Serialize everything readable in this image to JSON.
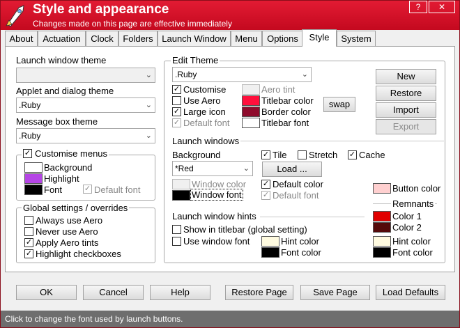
{
  "header": {
    "title": "Style and appearance",
    "subtitle": "Changes made on this page are effective immediately",
    "help_glyph": "?",
    "close_glyph": "✕"
  },
  "tabs": [
    {
      "label": "About"
    },
    {
      "label": "Actuation"
    },
    {
      "label": "Clock"
    },
    {
      "label": "Folders"
    },
    {
      "label": "Launch Window"
    },
    {
      "label": "Menu"
    },
    {
      "label": "Options"
    },
    {
      "label": "Style"
    },
    {
      "label": "System"
    }
  ],
  "active_tab": "Style",
  "left": {
    "launch_window_theme_label": "Launch window theme",
    "launch_window_theme_value": "",
    "applet_theme_label": "Applet and dialog theme",
    "applet_theme_value": ".Ruby",
    "message_box_theme_label": "Message box theme",
    "message_box_theme_value": ".Ruby",
    "customise_menus": {
      "label": "Customise menus",
      "checked": true,
      "background_label": "Background",
      "highlight_label": "Highlight",
      "font_label": "Font",
      "default_font_label": "Default font",
      "default_font_checked": true
    },
    "global": {
      "title": "Global settings / overrides",
      "items": [
        {
          "label": "Always use Aero",
          "checked": false
        },
        {
          "label": "Never use Aero",
          "checked": false
        },
        {
          "label": "Apply Aero tints",
          "checked": true
        },
        {
          "label": "Highlight checkboxes",
          "checked": true
        }
      ]
    }
  },
  "edit_theme": {
    "title": "Edit Theme",
    "theme_value": ".Ruby",
    "customise": "Customise",
    "use_aero": "Use Aero",
    "large_icon": "Large icon",
    "default_font": "Default font",
    "aero_tint": "Aero tint",
    "titlebar_color": "Titlebar color",
    "border_color": "Border color",
    "titlebar_font": "Titlebar font",
    "swap": "swap",
    "buttons": {
      "new": "New",
      "restore": "Restore",
      "import": "Import",
      "export": "Export"
    }
  },
  "launch_windows": {
    "title": "Launch windows",
    "background_label": "Background",
    "background_value": "*Red",
    "tile": "Tile",
    "stretch": "Stretch",
    "cache": "Cache",
    "load": "Load ...",
    "window_color": "Window color",
    "window_font": "Window font",
    "default_color": "Default color",
    "default_font": "Default font",
    "button_color": "Button color",
    "remnants": "Remnants",
    "color1": "Color 1",
    "color2": "Color 2"
  },
  "hints": {
    "title": "Launch window hints",
    "show_in_titlebar": "Show in titlebar (global setting)",
    "use_window_font": "Use window font",
    "hint_color": "Hint color",
    "font_color": "Font color",
    "hint_color_right": "Hint color",
    "font_color_right": "Font color"
  },
  "footer": {
    "ok": "OK",
    "cancel": "Cancel",
    "help": "Help",
    "restore_page": "Restore Page",
    "save_page": "Save Page",
    "load_defaults": "Load Defaults"
  },
  "status": "Click to change the font used by launch buttons.",
  "colors": {
    "titlebar_red": "#e21b33",
    "menu_background": "#ffffff",
    "menu_highlight": "#b545e5",
    "menu_font": "#000000",
    "aero_tint": "#f0f0f0",
    "titlebar_color": "#ff0f3c",
    "border_color": "#8e0a2b",
    "titlebar_font": "#ffffff",
    "window_color": "#f0f0f0",
    "window_font": "#000000",
    "button_color": "#ffd0d0",
    "remnant_color1": "#e00000",
    "remnant_color2": "#540a0a",
    "hint_color": "#fffbe0",
    "hint_font_color": "#000000"
  }
}
